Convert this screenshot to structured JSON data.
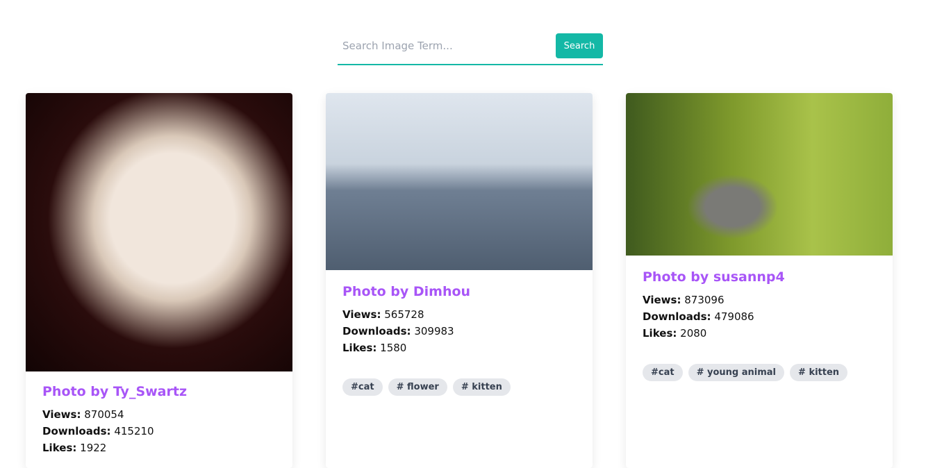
{
  "search": {
    "placeholder": "Search Image Term...",
    "button": "Search"
  },
  "cards": [
    {
      "title": "Photo by Ty_Swartz",
      "views": "870054",
      "downloads": "415210",
      "likes": "1922",
      "tags": []
    },
    {
      "title": "Photo by Dimhou",
      "views": "565728",
      "downloads": "309983",
      "likes": "1580",
      "tags": [
        "#cat",
        "# flower",
        "# kitten"
      ]
    },
    {
      "title": "Photo by susannp4",
      "views": "873096",
      "downloads": "479086",
      "likes": "2080",
      "tags": [
        "#cat",
        "# young animal",
        "# kitten"
      ]
    }
  ],
  "labels": {
    "views": "Views:",
    "downloads": "Downloads:",
    "likes": "Likes:"
  }
}
